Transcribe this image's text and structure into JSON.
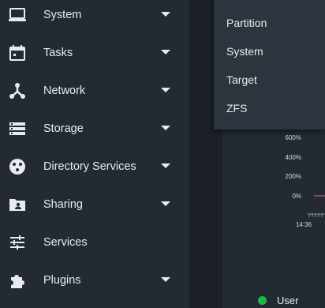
{
  "sidebar": {
    "items": [
      {
        "label": "System",
        "icon": "laptop-icon",
        "has_submenu": true
      },
      {
        "label": "Tasks",
        "icon": "calendar-icon",
        "has_submenu": true
      },
      {
        "label": "Network",
        "icon": "network-icon",
        "has_submenu": true
      },
      {
        "label": "Storage",
        "icon": "storage-icon",
        "has_submenu": true
      },
      {
        "label": "Directory Services",
        "icon": "directory-services-icon",
        "has_submenu": true
      },
      {
        "label": "Sharing",
        "icon": "folder-shared-icon",
        "has_submenu": true
      },
      {
        "label": "Services",
        "icon": "tune-icon",
        "has_submenu": false
      },
      {
        "label": "Plugins",
        "icon": "puzzle-icon",
        "has_submenu": true
      }
    ]
  },
  "dropdown": {
    "items": [
      "Partition",
      "System",
      "Target",
      "ZFS"
    ]
  },
  "chart": {
    "y_ticks": [
      "600%",
      "400%",
      "200%",
      "0%"
    ],
    "x_tick": "14:36",
    "legend_label": "User"
  },
  "colors": {
    "sidebar_bg": "#232a32",
    "main_bg": "#1b2026",
    "text": "#e9ecef",
    "user_series": "#1fb845",
    "line": "#c05a9a"
  }
}
